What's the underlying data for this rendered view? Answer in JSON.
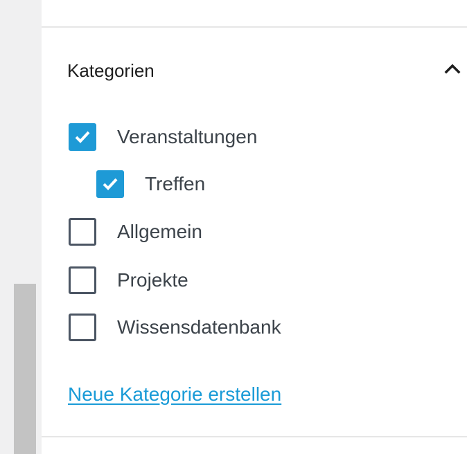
{
  "panel": {
    "title": "Kategorien",
    "collapse_icon": "chevron-up-icon"
  },
  "categories": [
    {
      "label": "Veranstaltungen",
      "checked": true,
      "level": 0
    },
    {
      "label": "Treffen",
      "checked": true,
      "level": 1
    },
    {
      "label": "Allgemein",
      "checked": false,
      "level": 0
    },
    {
      "label": "Projekte",
      "checked": false,
      "level": 0
    },
    {
      "label": "Wissensdatenbank",
      "checked": false,
      "level": 0
    }
  ],
  "add_category_link": "Neue Kategorie erstellen",
  "colors": {
    "accent": "#1e9ad6",
    "link": "#1a9bd7",
    "checkbox_border": "#4b5563",
    "text": "#3c434a"
  }
}
